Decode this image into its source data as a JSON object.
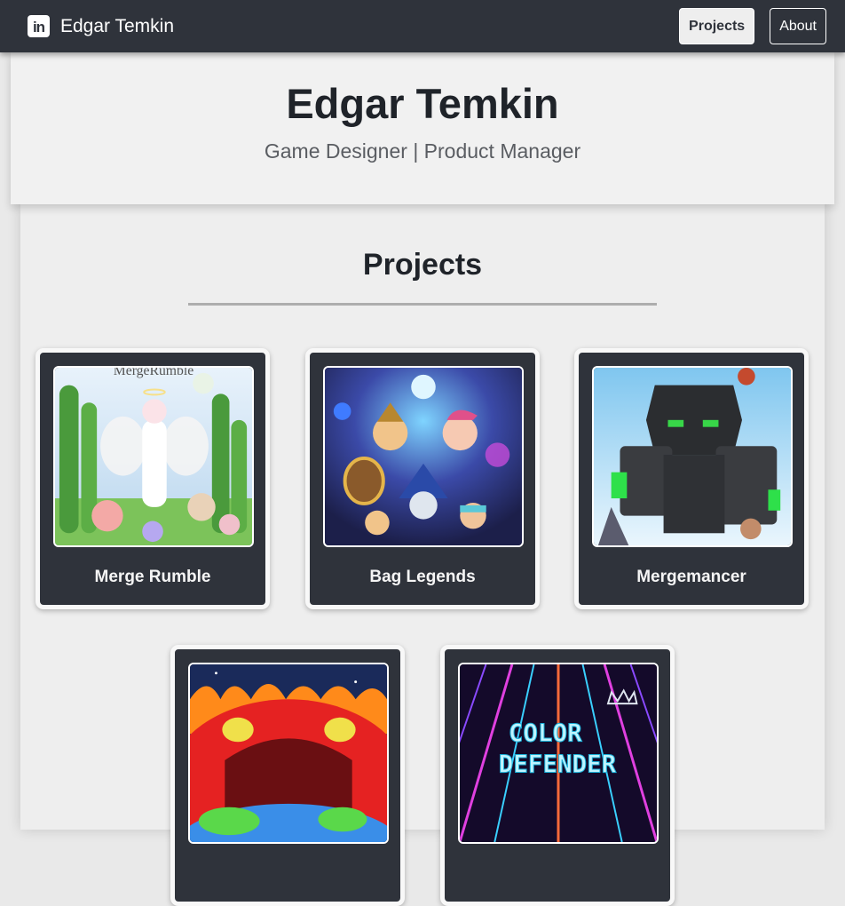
{
  "nav": {
    "brand_name": "Edgar Temkin",
    "brand_icon": "linkedin-icon",
    "brand_icon_text": "in",
    "buttons": [
      {
        "label": "Projects",
        "active": true
      },
      {
        "label": "About",
        "active": false
      }
    ]
  },
  "hero": {
    "name": "Edgar Temkin",
    "subtitle": "Game Designer | Product Manager"
  },
  "projects": {
    "heading": "Projects",
    "items": [
      {
        "title": "Merge Rumble",
        "art_text": "MergeRumble"
      },
      {
        "title": "Bag Legends"
      },
      {
        "title": "Mergemancer"
      },
      {
        "title": ""
      },
      {
        "title": "",
        "art_text_line1": "COLOR",
        "art_text_line2": "DEFENDER"
      }
    ]
  },
  "colors": {
    "navbar": "#2f333b",
    "card": "#2f333b",
    "page": "#e9e9e9",
    "hero": "#f1f1f1"
  }
}
